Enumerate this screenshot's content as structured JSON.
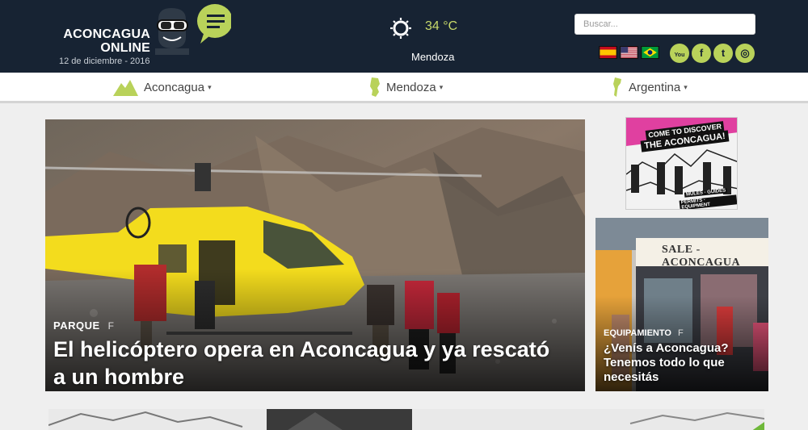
{
  "header": {
    "logo_line1": "ACONCAGUA",
    "logo_line2": "ONLINE",
    "date": "12 de diciembre - 2016",
    "weather_temp": "34 °C",
    "weather_city": "Mendoza",
    "weather_icon": "sun-icon",
    "search_placeholder": "Buscar...",
    "flags": [
      "spain-flag-icon",
      "usa-flag-icon",
      "brazil-flag-icon"
    ],
    "social": [
      "youtube-icon",
      "facebook-icon",
      "twitter-icon",
      "instagram-icon"
    ],
    "social_glyphs": [
      "You",
      "f",
      "t",
      "◎"
    ]
  },
  "nav": {
    "items": [
      {
        "label": "Aconcagua",
        "icon": "mountain-icon"
      },
      {
        "label": "Mendoza",
        "icon": "mendoza-map-icon"
      },
      {
        "label": "Argentina",
        "icon": "argentina-map-icon"
      }
    ],
    "caret": "▾"
  },
  "hero": {
    "category": "PARQUE",
    "share": "f",
    "title": "El helicóptero opera en Aconcagua y ya rescató a un hombre"
  },
  "ad": {
    "line1": "COME TO DISCOVER",
    "line2": "THE ACONCAGUA!",
    "footer1": "MULES · GUIDES",
    "footer2": "PERMITS · EQUIPMENT"
  },
  "card": {
    "category": "EQUIPAMIENTO",
    "share": "f",
    "title": "¿Venís a Aconcagua? Tenemos todo lo que necesitás",
    "store_sign": "SALE - ACONCAGUA"
  },
  "colors": {
    "header_bg": "#172333",
    "accent_green": "#b9d25a",
    "temp_color": "#c7d96a"
  }
}
